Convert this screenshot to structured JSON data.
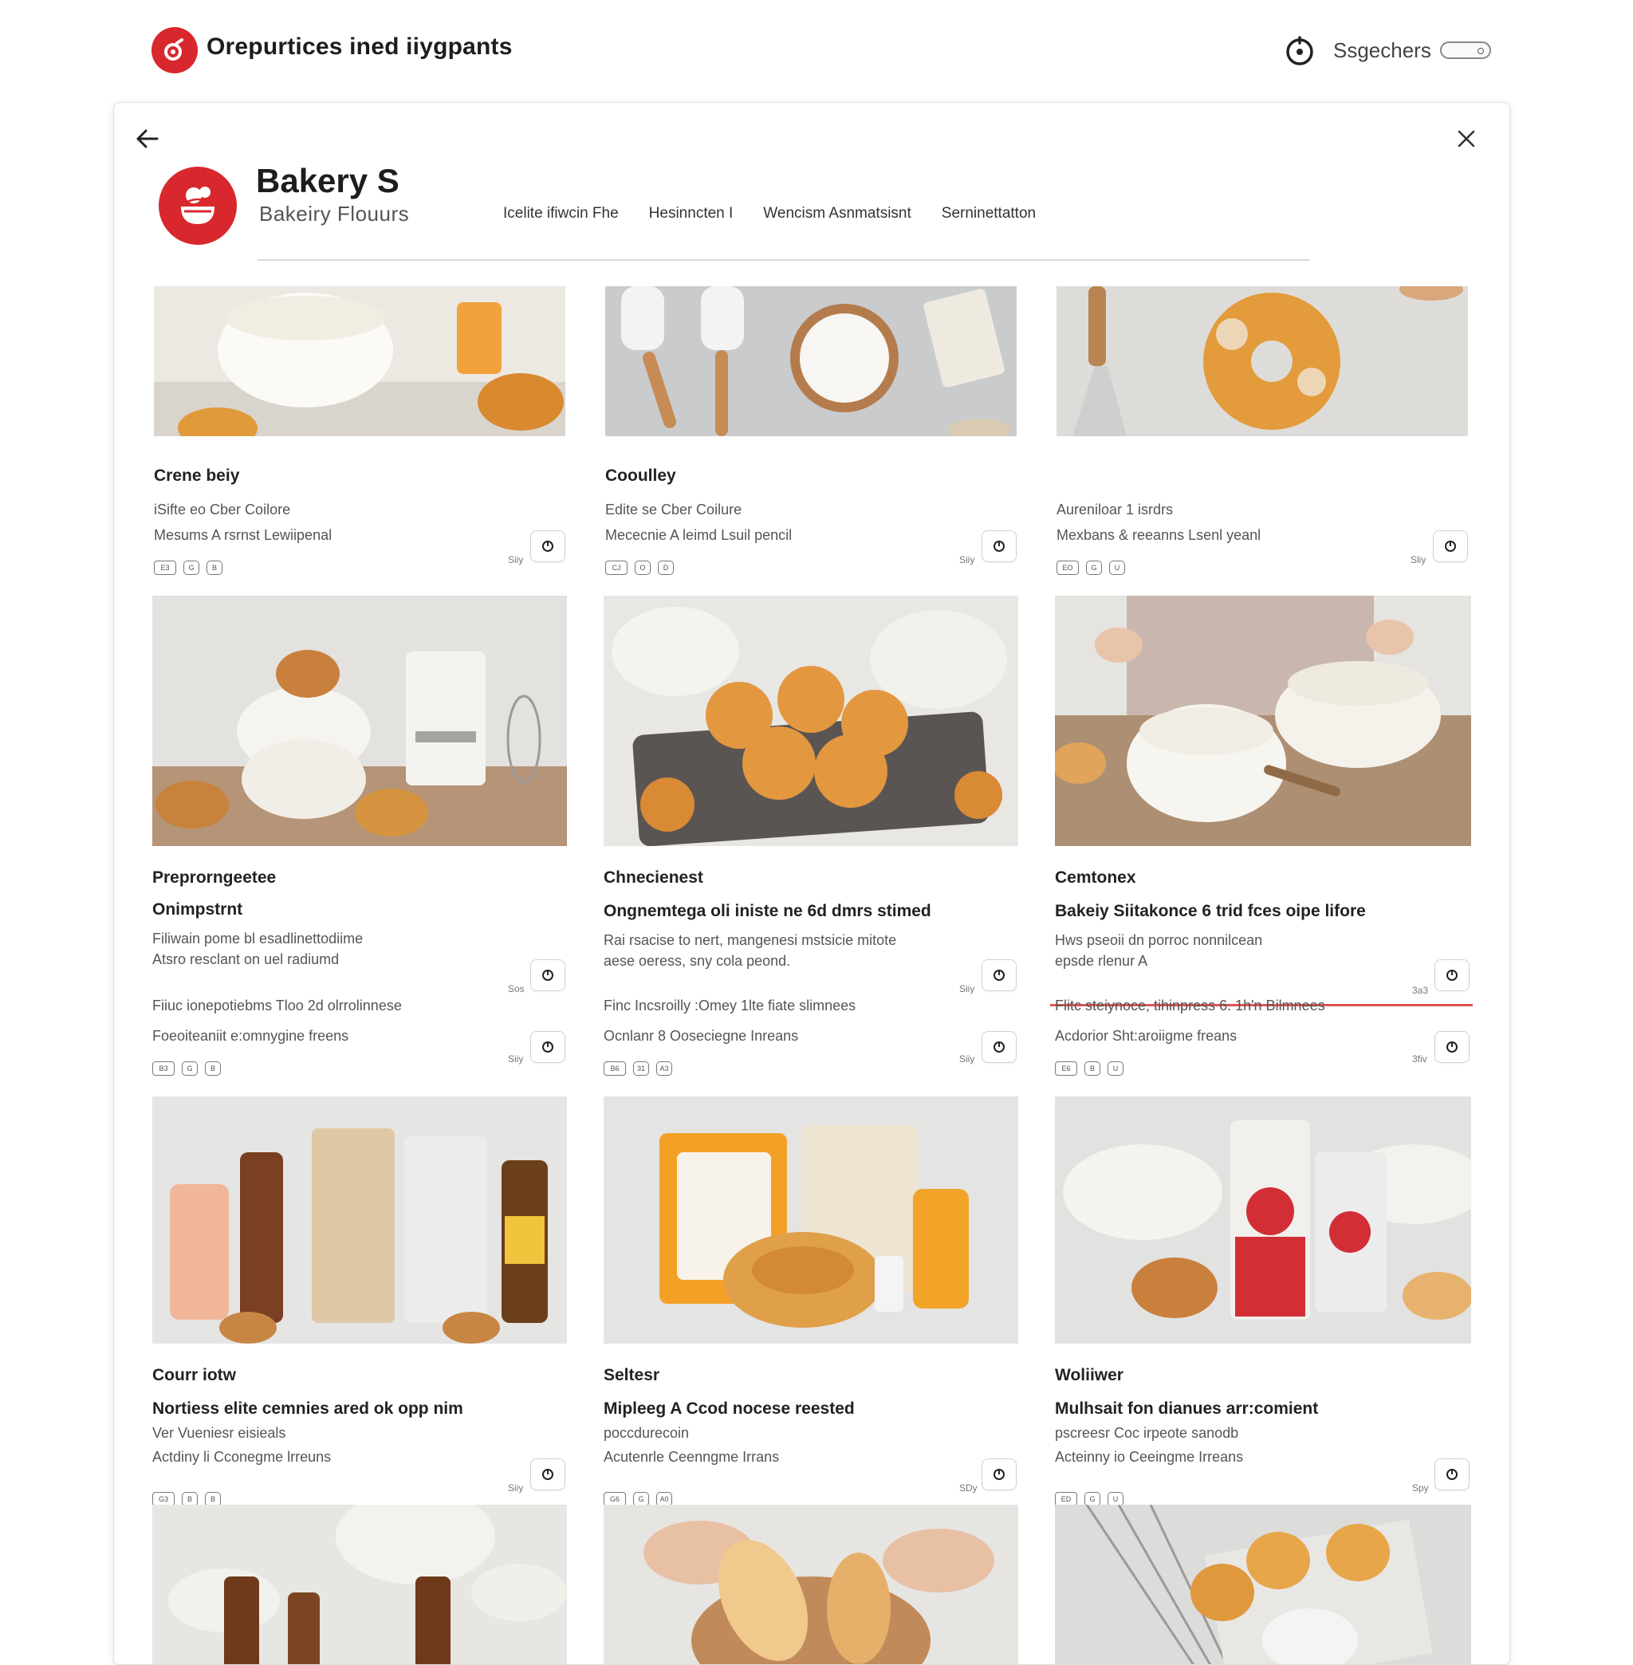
{
  "app": {
    "title": "Orepurtices ined iiygpants",
    "user_label": "Ssgechers"
  },
  "brand": {
    "name": "Bakery S",
    "subtitle": "Bakeiry Flouurs"
  },
  "nav": [
    "Icelite ifiwcin Fhe",
    "Hesinncten I",
    "Wencism Asnmatsisnt",
    "Serninettatton"
  ],
  "colors": {
    "accent": "#d9272e",
    "divider_highlight": "#e05353"
  },
  "cards": [
    {
      "title": "Crene beiy",
      "lines": [
        "iSifte eo Cber Coilore",
        "Mesums A rsrnst Lewiipenal"
      ],
      "price": "Siiy",
      "chips": [
        "E3",
        "G",
        "B"
      ]
    },
    {
      "title": "Cooulley",
      "lines": [
        "Edite se Cber Coilure",
        "Mececnie A leimd Lsuil pencil"
      ],
      "price": "Siiy",
      "chips": [
        "CJ",
        "O",
        "D"
      ]
    },
    {
      "title": "",
      "lines": [
        "Aureniloar 1 isrdrs",
        "Mexbans & reeanns Lsenl yeanl"
      ],
      "price": "Sliy",
      "chips": [
        "EO",
        "G",
        "U"
      ]
    },
    {
      "title": "Preprorngeetee",
      "subtitle": "Onimpstrnt",
      "lines": [
        "Filiwain pome bl esadlinettodiime",
        "Atsro resclant on uel radiumd"
      ],
      "price": "Sos",
      "chips": []
    },
    {
      "title": "Chnecienest",
      "subtitle": "Ongnemtega oli iniste ne 6d dmrs stimed",
      "lines": [
        "Rai rsacise to nert, mangenesi mstsicie mitote",
        "aese oeress, sny cola peond."
      ],
      "price": "Siiy",
      "chips": []
    },
    {
      "title": "Cemtonex",
      "subtitle": "Bakeiy Siitakonce 6 trid fces oipe lifore",
      "lines": [
        "Hws pseoii dn porroc nonnilcean",
        "epsde rlenur A"
      ],
      "price": "3a3",
      "chips": []
    },
    {
      "title": "",
      "lines": [
        "Fiiuc ionepotiebms Tloo 2d olrrolinnese",
        "Foeoiteaniit e:omnygine freens"
      ],
      "price": "Siiy",
      "chips": [
        "B3",
        "G",
        "B"
      ]
    },
    {
      "title": "",
      "lines": [
        "Finc Incsroilly :Omey 1lte fiate slimnees",
        "Ocnlanr 8 Ooseciegne Inreans"
      ],
      "price": "Siiy",
      "chips": [
        "B6",
        "31",
        "A3"
      ]
    },
    {
      "title": "",
      "lines": [
        "Flitc steiynoce, tihinpress 6. 1h'n Bilmnees",
        "Acdorior Sht:aroiigme freans"
      ],
      "price": "3fiv",
      "chips": [
        "E6",
        "B",
        "U"
      ]
    },
    {
      "title": "Courr iotw",
      "subtitle": "Nortiess elite cemnies ared ok opp nim",
      "lines": [
        "Ver Vueniesr eisieals",
        "Actdiny li Cconegme lrreuns"
      ],
      "price": "Siiy",
      "chips": [
        "G3",
        "B",
        "B"
      ]
    },
    {
      "title": "Seltesr",
      "subtitle": "Mipleeg A Ccod nocese reested",
      "lines": [
        "poccdurecoin",
        "Acutenrle Ceenngme Irrans"
      ],
      "price": "SDy",
      "chips": [
        "G6",
        "G",
        "A0"
      ]
    },
    {
      "title": "Woliiwer",
      "subtitle": "Mulhsait fon dianues arr:comient",
      "lines": [
        "pscreesr Coc irpeote sanodb",
        "Acteinny io Ceeingme Irreans"
      ],
      "price": "Spy",
      "chips": [
        "ED",
        "G",
        "U"
      ]
    }
  ]
}
